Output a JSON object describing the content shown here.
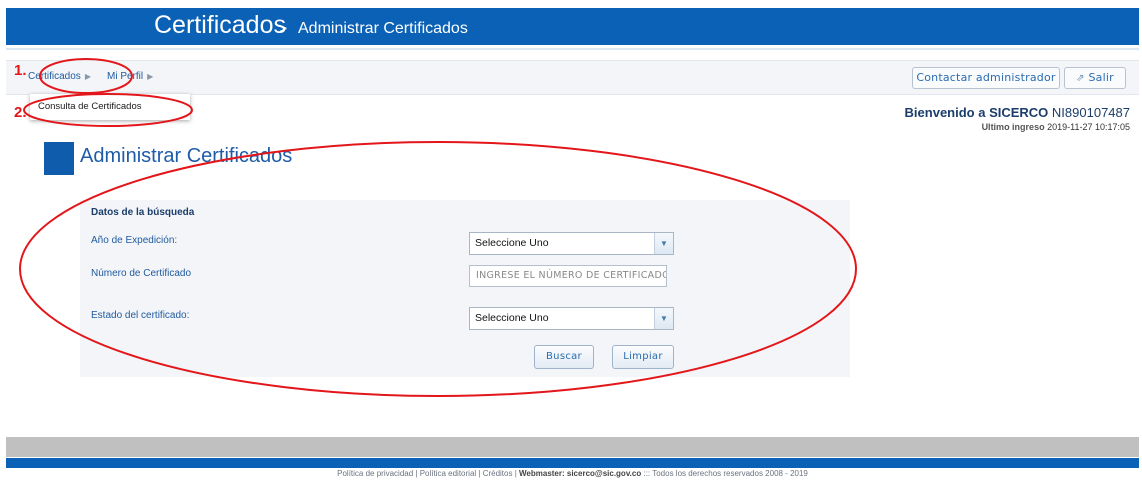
{
  "header": {
    "app_title": "Certificados",
    "separator": ">",
    "page_crumb": "Administrar Certificados"
  },
  "nav": {
    "items": [
      {
        "label": "Certificados",
        "caret": "▶"
      },
      {
        "label": "Mi Perfil",
        "caret": "▶"
      }
    ],
    "contact_button": "Contactar administrador",
    "logout_button": "Salir",
    "logout_icon": "external-link-icon"
  },
  "dropdown": {
    "items": [
      "Consulta de Certificados"
    ]
  },
  "annotations": {
    "step1": "1.",
    "step2": "2.",
    "color": "#e3161a"
  },
  "welcome": {
    "greeting": "Bienvenido a SICERCO",
    "user_code": "NI890107487",
    "last_login_label": "Ultimo ingreso",
    "last_login_value": "2019-11-27 10:17:05"
  },
  "page": {
    "title": "Administrar Certificados"
  },
  "search_form": {
    "section_title": "Datos de la búsqueda",
    "year_label": "Año de Expedición:",
    "year_value": "Seleccione Uno",
    "number_label": "Número de Certificado",
    "number_placeholder": "INGRESE EL NÚMERO DE CERTIFICADO",
    "status_label": "Estado del certificado:",
    "status_value": "Seleccione Uno",
    "search_button": "Buscar",
    "clear_button": "Limpiar"
  },
  "footer": {
    "links": "Política de privacidad | Política editorial | Créditos |",
    "webmaster": "Webmaster: sicerco@sic.gov.co",
    "rights": "::: Todos los derechos reservados 2008 - 2019"
  },
  "colors": {
    "brand_blue": "#0a61b5",
    "annotation_red": "#e3161a"
  }
}
